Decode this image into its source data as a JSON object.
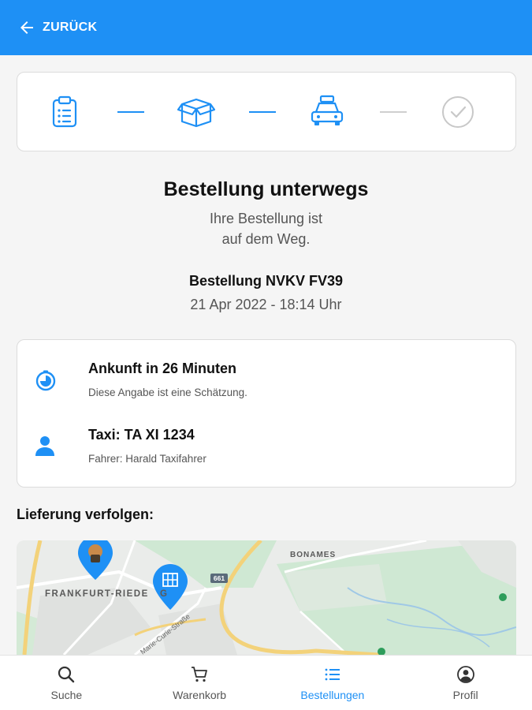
{
  "appbar": {
    "back_label": "ZURÜCK"
  },
  "stepper": {
    "steps": [
      {
        "icon": "clipboard-list-icon",
        "state": "done"
      },
      {
        "icon": "open-box-icon",
        "state": "done"
      },
      {
        "icon": "taxi-icon",
        "state": "active"
      },
      {
        "icon": "check-circle-icon",
        "state": "pending"
      }
    ]
  },
  "status": {
    "title": "Bestellung unterwegs",
    "subtitle_line1": "Ihre Bestellung ist",
    "subtitle_line2": "auf dem Weg.",
    "order_number": "Bestellung NVKV FV39",
    "order_date": "21 Apr 2022 - 18:14 Uhr"
  },
  "info": {
    "arrival_title": "Ankunft in 26 Minuten",
    "arrival_note": "Diese Angabe ist eine Schätzung.",
    "taxi_title": "Taxi: TA XI 1234",
    "driver": "Fahrer: Harald Taxifahrer"
  },
  "tracking": {
    "label": "Lieferung verfolgen:",
    "map_labels": {
      "district": "FRANKFURT-RIEDE",
      "district_tail": "G",
      "area": "BONAMES",
      "road_shield": "661",
      "street": "Marie-Curie-Straße"
    }
  },
  "nav": {
    "items": [
      {
        "label": "Suche",
        "icon": "search-icon",
        "active": false
      },
      {
        "label": "Warenkorb",
        "icon": "cart-icon",
        "active": false
      },
      {
        "label": "Bestellungen",
        "icon": "list-icon",
        "active": true
      },
      {
        "label": "Profil",
        "icon": "profile-icon",
        "active": false
      }
    ]
  },
  "colors": {
    "primary": "#1e90f5",
    "inactive": "#c8c8c8",
    "text": "#111111",
    "muted": "#555555"
  }
}
